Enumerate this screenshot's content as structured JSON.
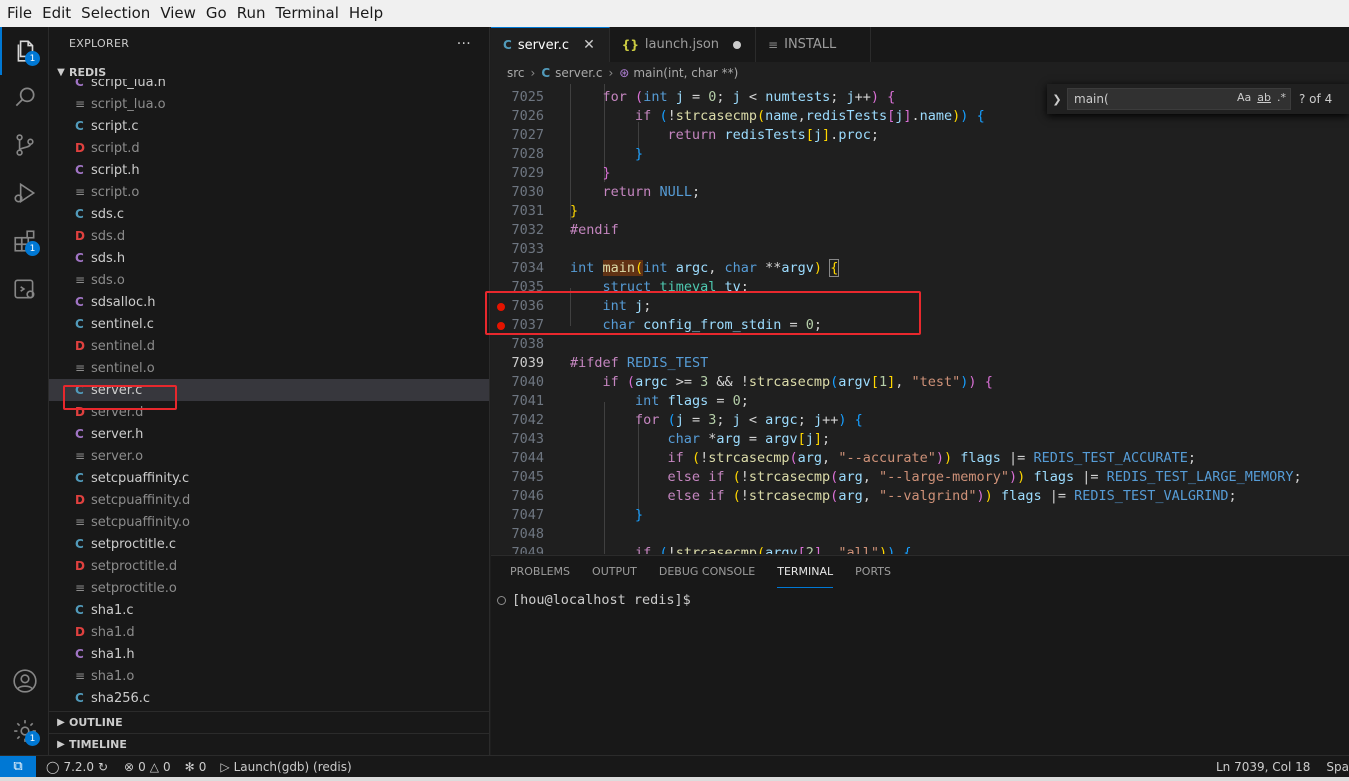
{
  "menu": [
    "File",
    "Edit",
    "Selection",
    "View",
    "Go",
    "Run",
    "Terminal",
    "Help"
  ],
  "activity": {
    "explorer_badge": "1",
    "extensions_badge": "1",
    "settings_badge": "1"
  },
  "sidebar": {
    "title": "EXPLORER",
    "more": "···",
    "section": "REDIS",
    "files": [
      {
        "name": "script_lua.h",
        "icon": "C",
        "type": "h"
      },
      {
        "name": "script_lua.o",
        "icon": "≡",
        "type": "o"
      },
      {
        "name": "script.c",
        "icon": "C",
        "type": "c"
      },
      {
        "name": "script.d",
        "icon": "D",
        "type": "d"
      },
      {
        "name": "script.h",
        "icon": "C",
        "type": "h"
      },
      {
        "name": "script.o",
        "icon": "≡",
        "type": "o"
      },
      {
        "name": "sds.c",
        "icon": "C",
        "type": "c"
      },
      {
        "name": "sds.d",
        "icon": "D",
        "type": "d"
      },
      {
        "name": "sds.h",
        "icon": "C",
        "type": "h"
      },
      {
        "name": "sds.o",
        "icon": "≡",
        "type": "o"
      },
      {
        "name": "sdsalloc.h",
        "icon": "C",
        "type": "h"
      },
      {
        "name": "sentinel.c",
        "icon": "C",
        "type": "c"
      },
      {
        "name": "sentinel.d",
        "icon": "D",
        "type": "d"
      },
      {
        "name": "sentinel.o",
        "icon": "≡",
        "type": "o"
      },
      {
        "name": "server.c",
        "icon": "C",
        "type": "c"
      },
      {
        "name": "server.d",
        "icon": "D",
        "type": "d"
      },
      {
        "name": "server.h",
        "icon": "C",
        "type": "h"
      },
      {
        "name": "server.o",
        "icon": "≡",
        "type": "o"
      },
      {
        "name": "setcpuaffinity.c",
        "icon": "C",
        "type": "c"
      },
      {
        "name": "setcpuaffinity.d",
        "icon": "D",
        "type": "d"
      },
      {
        "name": "setcpuaffinity.o",
        "icon": "≡",
        "type": "o"
      },
      {
        "name": "setproctitle.c",
        "icon": "C",
        "type": "c"
      },
      {
        "name": "setproctitle.d",
        "icon": "D",
        "type": "d"
      },
      {
        "name": "setproctitle.o",
        "icon": "≡",
        "type": "o"
      },
      {
        "name": "sha1.c",
        "icon": "C",
        "type": "c"
      },
      {
        "name": "sha1.d",
        "icon": "D",
        "type": "d"
      },
      {
        "name": "sha1.h",
        "icon": "C",
        "type": "h"
      },
      {
        "name": "sha1.o",
        "icon": "≡",
        "type": "o"
      },
      {
        "name": "sha256.c",
        "icon": "C",
        "type": "c"
      }
    ],
    "outline": "OUTLINE",
    "timeline": "TIMELINE"
  },
  "tabs": [
    {
      "icon": "C",
      "label": "server.c",
      "state": "close",
      "active": true
    },
    {
      "icon": "{}",
      "label": "launch.json",
      "state": "dirty",
      "active": false
    },
    {
      "icon": "≡",
      "label": "INSTALL",
      "state": "none",
      "active": false
    }
  ],
  "breadcrumbs": {
    "folder": "src",
    "file_icon": "C",
    "file": "server.c",
    "symbol": "main(int, char **)"
  },
  "find": {
    "query": "main(",
    "case": "Aa",
    "word": "ab",
    "regex": ".*",
    "count": "? of 4"
  },
  "editor": {
    "current_line": "7039",
    "lines": [
      {
        "n": "7025"
      },
      {
        "n": "7026"
      },
      {
        "n": "7027"
      },
      {
        "n": "7028"
      },
      {
        "n": "7029"
      },
      {
        "n": "7030"
      },
      {
        "n": "7031"
      },
      {
        "n": "7032"
      },
      {
        "n": "7033"
      },
      {
        "n": "7034"
      },
      {
        "n": "7035"
      },
      {
        "n": "7036"
      },
      {
        "n": "7037"
      },
      {
        "n": "7038"
      },
      {
        "n": "7039"
      },
      {
        "n": "7040"
      },
      {
        "n": "7041"
      },
      {
        "n": "7042"
      },
      {
        "n": "7043"
      },
      {
        "n": "7044"
      },
      {
        "n": "7045"
      },
      {
        "n": "7046"
      },
      {
        "n": "7047"
      },
      {
        "n": "7048"
      },
      {
        "n": "7049"
      }
    ]
  },
  "panel": {
    "tabs": [
      "PROBLEMS",
      "OUTPUT",
      "DEBUG CONSOLE",
      "TERMINAL",
      "PORTS"
    ],
    "active_tab": "TERMINAL",
    "prompt": "[hou@localhost redis]$"
  },
  "status": {
    "version": "7.2.0",
    "errors": "0",
    "warnings": "0",
    "debug_count": "0",
    "launch": "Launch(gdb) (redis)",
    "position": "Ln 7039, Col 18",
    "spaces": "Spa"
  }
}
